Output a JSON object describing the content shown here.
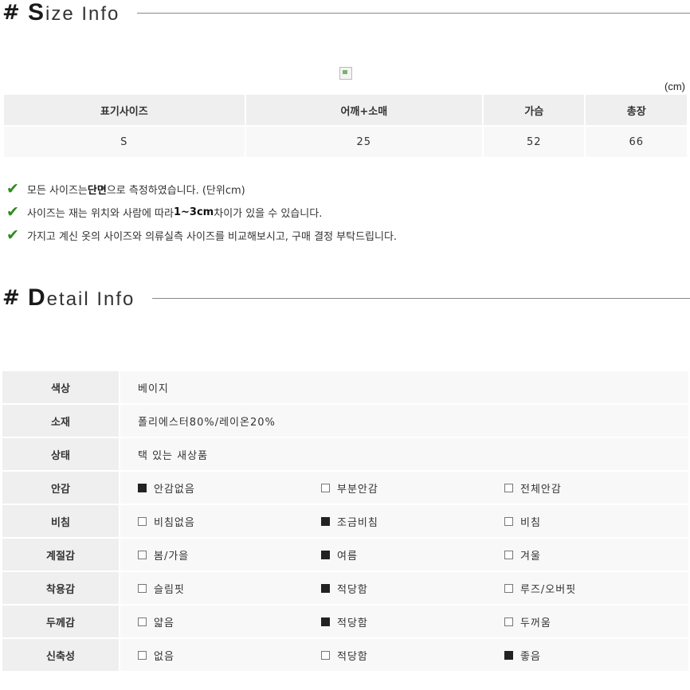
{
  "size_section": {
    "hash": "#",
    "title_cap": "S",
    "title_rest": "ize Info",
    "unit": "(cm)",
    "headers": [
      "표기사이즈",
      "어깨+소매",
      "가슴",
      "총장"
    ],
    "row": [
      "S",
      "25",
      "52",
      "66"
    ]
  },
  "notes": [
    {
      "pre": "모든 사이즈는 ",
      "bold": "단면",
      "post": " 으로 측정하였습니다. (단위cm)"
    },
    {
      "pre": "사이즈는 재는 위치와 사람에 따라 ",
      "bold": "1~3cm",
      "post": "차이가 있을 수 있습니다."
    },
    {
      "pre": "가지고 계신 옷의 사이즈와 의류실측 사이즈를 비교해보시고, 구매 결정 부탁드립니다.",
      "bold": "",
      "post": ""
    }
  ],
  "detail_section": {
    "hash": "#",
    "title_cap": "D",
    "title_rest": "etail Info",
    "rows": [
      {
        "label": "색상",
        "value": "베이지"
      },
      {
        "label": "소재",
        "value": "폴리에스터80%/레이온20%"
      },
      {
        "label": "상태",
        "value": "택 있는 새상품"
      },
      {
        "label": "안감",
        "options": [
          {
            "text": "안감없음",
            "checked": true
          },
          {
            "text": "부분안감",
            "checked": false
          },
          {
            "text": "전체안감",
            "checked": false
          }
        ]
      },
      {
        "label": "비침",
        "options": [
          {
            "text": "비침없음",
            "checked": false
          },
          {
            "text": "조금비침",
            "checked": true
          },
          {
            "text": "비침",
            "checked": false
          }
        ]
      },
      {
        "label": "계절감",
        "options": [
          {
            "text": "봄/가을",
            "checked": false
          },
          {
            "text": "여름",
            "checked": true
          },
          {
            "text": "겨울",
            "checked": false
          }
        ]
      },
      {
        "label": "착용감",
        "options": [
          {
            "text": "슬림핏",
            "checked": false
          },
          {
            "text": "적당함",
            "checked": true
          },
          {
            "text": "루즈/오버핏",
            "checked": false
          }
        ]
      },
      {
        "label": "두께감",
        "options": [
          {
            "text": "얇음",
            "checked": false
          },
          {
            "text": "적당함",
            "checked": true
          },
          {
            "text": "두꺼움",
            "checked": false
          }
        ]
      },
      {
        "label": "신축성",
        "options": [
          {
            "text": "없음",
            "checked": false
          },
          {
            "text": "적당함",
            "checked": false
          },
          {
            "text": "좋음",
            "checked": true
          }
        ]
      }
    ]
  },
  "icons": {
    "check": "check-icon",
    "broken_image": "broken-image-icon"
  },
  "colors": {
    "check": "#2e8b1e",
    "header_bg": "#efefef",
    "cell_bg": "#f8f8f8"
  }
}
